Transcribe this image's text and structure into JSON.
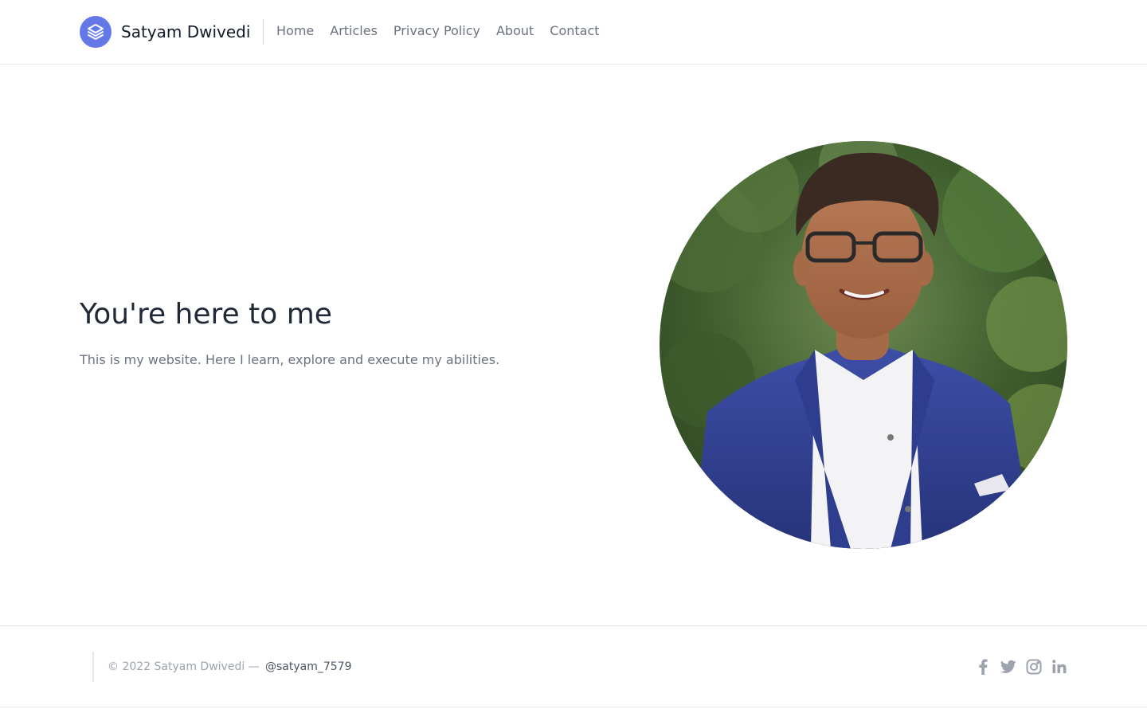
{
  "header": {
    "brand_name": "Satyam Dwivedi",
    "logo_icon": "stack-layers-icon",
    "nav": [
      {
        "label": "Home"
      },
      {
        "label": "Articles"
      },
      {
        "label": "Privacy Policy"
      },
      {
        "label": "About"
      },
      {
        "label": "Contact"
      }
    ]
  },
  "hero": {
    "title": "You're here to me",
    "subtitle": "This is my website. Here I learn, explore and execute my abilities.",
    "image": "portrait-photo"
  },
  "footer": {
    "copyright": "© 2022 Satyam Dwivedi —",
    "handle": "@satyam_7579",
    "socials": [
      "facebook-icon",
      "twitter-icon",
      "instagram-icon",
      "linkedin-icon"
    ]
  },
  "colors": {
    "accent": "#6478e8",
    "text_muted": "#6b7280",
    "heading": "#1f2937",
    "border": "#e5e7eb",
    "icon": "#9ca3af"
  }
}
